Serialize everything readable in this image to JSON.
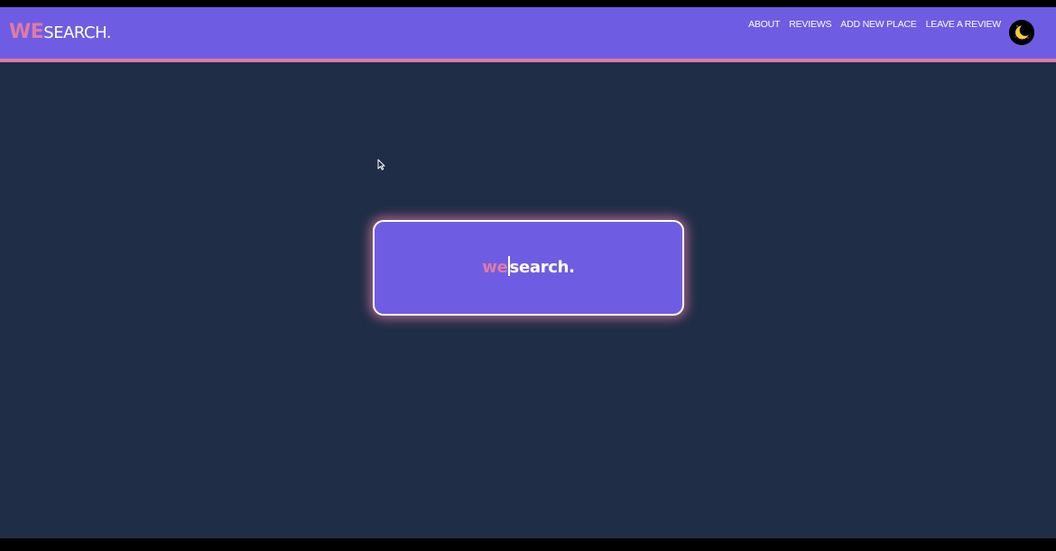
{
  "brand": {
    "prefix": "WE",
    "suffix": "SEARCH."
  },
  "nav": {
    "items": [
      {
        "label": "ABOUT"
      },
      {
        "label": "REVIEWS"
      },
      {
        "label": "ADD NEW PLACE"
      },
      {
        "label": "LEAVE A REVIEW"
      }
    ]
  },
  "theme_toggle": {
    "icon": "moon-icon",
    "mode": "dark"
  },
  "search": {
    "typed_text": "we",
    "remaining_text": "search.",
    "icon": "text-caret"
  },
  "colors": {
    "nav_background": "#6e5de3",
    "accent_pink": "#e07aa4",
    "page_background": "#1f2d46",
    "text_white": "#ffffff",
    "moon_yellow": "#f2c744"
  }
}
